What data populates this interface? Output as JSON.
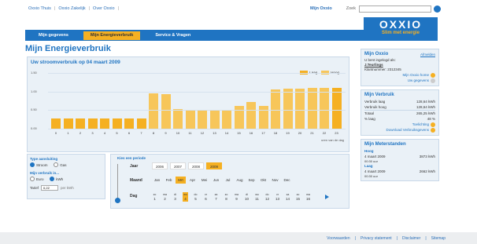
{
  "topbar": {
    "links": [
      "Oxxio Thuis",
      "Oxxio Zakelijk",
      "Over Oxxio"
    ],
    "mijn": "Mijn Oxxio",
    "search_label": "Zoek"
  },
  "logo": {
    "word": "OXXIO",
    "tagline": "Slim met energie"
  },
  "nav": {
    "tabs": [
      "Mijn gegevens",
      "Mijn Energieverbruik",
      "Service & Vragen"
    ]
  },
  "page": {
    "title": "Mijn Energieverbruik"
  },
  "chart": {
    "title": "Uw stroomverbruik op 04 maart 2009",
    "unit": "uren van de dag"
  },
  "chart_data": {
    "type": "bar",
    "title": "Uw stroomverbruik op 04 maart 2009",
    "xlabel": "uren van de dag",
    "ylabel": "kWh",
    "ylim": [
      0,
      1.5
    ],
    "yticks": [
      "1.50",
      "1.00",
      "0.50",
      "0.00"
    ],
    "categories": [
      "0",
      "1",
      "2",
      "3",
      "4",
      "5",
      "6",
      "7",
      "8",
      "9",
      "10",
      "11",
      "12",
      "13",
      "14",
      "15",
      "16",
      "17",
      "18",
      "19",
      "20",
      "21",
      "22",
      "23"
    ],
    "series": [
      {
        "name": "Laag",
        "color": "#f5b022"
      },
      {
        "name": "Hoog",
        "color": "#f7c65a"
      }
    ],
    "values": [
      0.28,
      0.27,
      0.27,
      0.27,
      0.27,
      0.28,
      0.27,
      0.28,
      0.96,
      0.94,
      0.52,
      0.5,
      0.5,
      0.5,
      0.5,
      0.62,
      0.71,
      0.62,
      1.05,
      1.08,
      1.08,
      1.09,
      1.1,
      1.1
    ],
    "bar_series": [
      "Laag",
      "Laag",
      "Laag",
      "Laag",
      "Laag",
      "Laag",
      "Laag",
      "Laag",
      "Hoog",
      "Hoog",
      "Hoog",
      "Hoog",
      "Hoog",
      "Hoog",
      "Hoog",
      "Hoog",
      "Hoog",
      "Hoog",
      "Hoog",
      "Hoog",
      "Hoog",
      "Hoog",
      "Hoog",
      "Laag"
    ],
    "grid": true,
    "legend": "top-right"
  },
  "type_aansluiting": {
    "title": "Type aansluiting",
    "options": [
      "Stroom",
      "Gas"
    ],
    "selected": "Stroom"
  },
  "verbruik_in": {
    "title": "Mijn verbruik in...",
    "options": [
      "Euro",
      "kWh"
    ],
    "selected": "kWh"
  },
  "tarief": {
    "label": "Tarief",
    "value": "0,22",
    "unit": "per kWh"
  },
  "period": {
    "title": "Kies een periode",
    "labels": {
      "jaar": "Jaar",
      "maand": "Maand",
      "dag": "Dag"
    },
    "years": [
      "2006",
      "2007",
      "2008",
      "2009"
    ],
    "selected_year": "2009",
    "months": [
      "Jan",
      "Feb",
      "Mrt",
      "Apr",
      "Mei",
      "Jun",
      "Jul",
      "Aug",
      "Sep",
      "Okt",
      "Nov",
      "Dec"
    ],
    "selected_month": "Mrt",
    "days": [
      {
        "w": "zo",
        "d": "1"
      },
      {
        "w": "ma",
        "d": "2"
      },
      {
        "w": "di",
        "d": "3"
      },
      {
        "w": "wo",
        "d": "4"
      },
      {
        "w": "do",
        "d": "5"
      },
      {
        "w": "vr",
        "d": "6"
      },
      {
        "w": "za",
        "d": "7"
      },
      {
        "w": "zo",
        "d": "8"
      },
      {
        "w": "ma",
        "d": "9"
      },
      {
        "w": "di",
        "d": "10"
      },
      {
        "w": "wo",
        "d": "11"
      },
      {
        "w": "do",
        "d": "12"
      },
      {
        "w": "vr",
        "d": "13"
      },
      {
        "w": "za",
        "d": "14"
      },
      {
        "w": "zo",
        "d": "15"
      },
      {
        "w": "ma",
        "d": "16"
      }
    ],
    "selected_day": "4"
  },
  "mijn_oxxio": {
    "title": "Mijn Oxxio",
    "logout": "Afmelden",
    "ingelogd": "U bent ingelogd als:",
    "naam": "J.Teurlings",
    "klantnummer_label": "Klantnummer:",
    "klantnummer": "2312345",
    "home_link": "Mijn Oxxio home",
    "gegevens_link": "Uw gegevens"
  },
  "mijn_verbruik": {
    "title": "Mijn Verbruik",
    "rows": [
      {
        "l": "Verbruik laag",
        "v": "128,64 kWh"
      },
      {
        "l": "Verbruik hoog",
        "v": "128,64 kWh"
      },
      {
        "l": "Totaal",
        "v": "265,25 kWh"
      },
      {
        "l": "% laag",
        "v": "48 %"
      }
    ],
    "link1": "Toelichting",
    "link2": "Download Verbruiksgevens"
  },
  "meterstanden": {
    "title": "Mijn Meterstanden",
    "groups": [
      {
        "label": "Hoog",
        "date": "4 maart 2009",
        "time": "00:30 uur",
        "value": "3873 kWh"
      },
      {
        "label": "Laag",
        "date": "4 maart 2009",
        "time": "00:30 uur",
        "value": "2662 kWh"
      }
    ]
  },
  "footer": {
    "links": [
      "Voorwaarden",
      "Privacy statement",
      "Disclaimer",
      "Sitemap"
    ]
  }
}
